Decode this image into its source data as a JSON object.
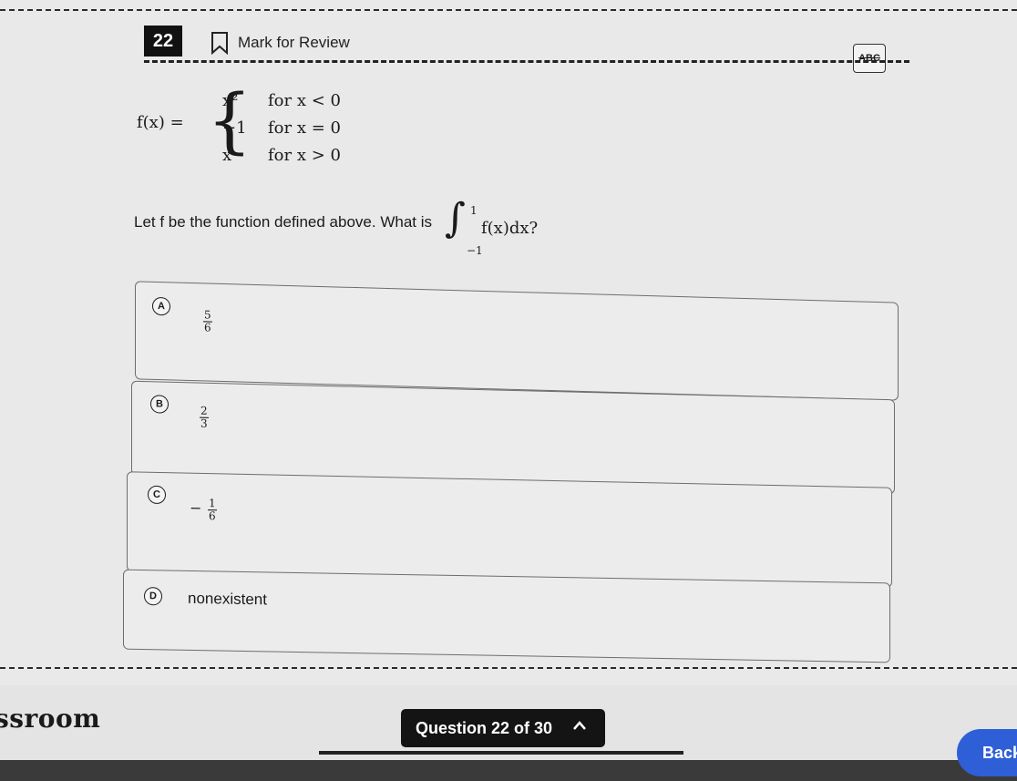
{
  "header": {
    "question_number": "22",
    "mark_for_review": "Mark for Review",
    "tool_label": "ABC"
  },
  "question": {
    "function_lhs": "f(x) =",
    "cases": [
      {
        "value": "x²",
        "condition": "for x < 0"
      },
      {
        "value": "−1",
        "condition": "for x = 0"
      },
      {
        "value": "x",
        "condition": "for x > 0"
      }
    ],
    "prompt": "Let f be the function defined above. What is",
    "integral_upper": "1",
    "integral_lower": "−1",
    "integrand": "f(x)dx?"
  },
  "choices": [
    {
      "letter": "A",
      "numerator": "5",
      "denominator": "6"
    },
    {
      "letter": "B",
      "numerator": "2",
      "denominator": "3"
    },
    {
      "letter": "C",
      "sign": "−",
      "numerator": "1",
      "denominator": "6"
    },
    {
      "letter": "D",
      "text": "nonexistent"
    }
  ],
  "footer": {
    "brand": "ssroom",
    "question_counter": "Question 22 of 30",
    "back_label": "Back"
  }
}
